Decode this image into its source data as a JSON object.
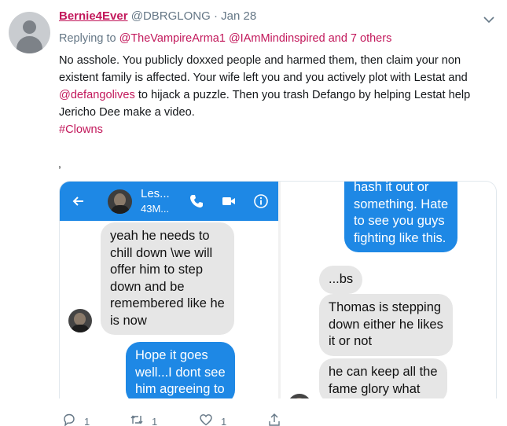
{
  "tweet": {
    "display_name": "Bernie4Ever",
    "handle": "@DBRGLONG",
    "separator": "·",
    "date": "Jan 28",
    "replying_prefix": "Replying to",
    "reply_mention_1": "@TheVampireArma1",
    "reply_mention_2": "@IAmMindinspired",
    "reply_suffix": "and 7 others",
    "text": {
      "line1": "No asshole. You publicly doxxed people and harmed them, then claim your non",
      "line2": "existent family is affected. Your wife left you and you actively plot with Lestat and",
      "line3_mention": "@defangolives",
      "line3_rest": " to hijack a puzzle. Then you trash Defango by helping Lestat help",
      "line4": "Jericho Dee make a video.",
      "hashtag": "#Clowns"
    },
    "stray_char": ","
  },
  "screenshot": {
    "header": {
      "contact_name": "Les...",
      "contact_status": "43M..."
    },
    "left_messages": [
      {
        "type": "received",
        "lines": [
          "yeah he needs to",
          "chill down \\we will",
          "offer him to step",
          "down and be",
          "remembered like he",
          "is now"
        ]
      },
      {
        "type": "sent",
        "lines": [
          "Hope it goes",
          "well...I dont see",
          "him agreeing to"
        ]
      }
    ],
    "right_messages": [
      {
        "type": "sent",
        "lines": [
          "hash it out or",
          "something.  Hate",
          "to see you guys",
          "fighting like this."
        ]
      },
      {
        "type": "received",
        "lines": [
          "...bs"
        ]
      },
      {
        "type": "received",
        "lines": [
          "Thomas is stepping",
          "down either he likes",
          "it  or not"
        ]
      },
      {
        "type": "received",
        "lines": [
          "he can keep all the",
          "fame glory what"
        ]
      }
    ]
  },
  "actions": {
    "reply_count": "1",
    "retweet_count": "1",
    "like_count": "1"
  },
  "colors": {
    "accent": "#c2185b",
    "messenger_blue": "#1e88e5",
    "muted": "#657786"
  },
  "icons": [
    "caret-down-icon",
    "back-arrow-icon",
    "phone-icon",
    "video-icon",
    "info-icon",
    "reply-icon",
    "retweet-icon",
    "like-icon",
    "share-icon"
  ]
}
